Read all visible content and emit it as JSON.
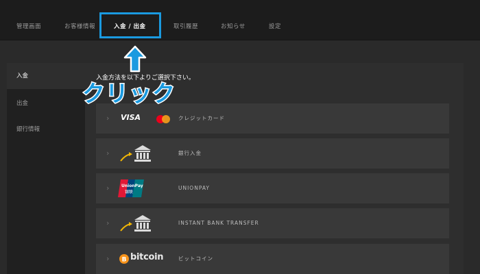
{
  "nav": {
    "tabs": [
      {
        "label": "管理画面"
      },
      {
        "label": "お客様情報"
      },
      {
        "label": "入金 / 出金"
      },
      {
        "label": "取引履歴"
      },
      {
        "label": "お知らせ"
      },
      {
        "label": "設定"
      }
    ],
    "active_tab": "入金 / 出金"
  },
  "annotation": {
    "callout_text": "クリック",
    "highlight_color": "#1a9ae0"
  },
  "sidebar": {
    "items": [
      {
        "label": "入金"
      },
      {
        "label": "出金"
      },
      {
        "label": "銀行情報"
      }
    ],
    "active_item": "入金"
  },
  "main": {
    "instruction": "入金方法を以下よりご選択下さい。",
    "methods": [
      {
        "logo": "visa-mastercard-logo",
        "logo_text": "VISA",
        "label": "クレジットカード"
      },
      {
        "logo": "bank-icon",
        "label": "銀行入金"
      },
      {
        "logo": "unionpay-logo",
        "label": "UNIONPAY"
      },
      {
        "logo": "bank-icon",
        "label": "INSTANT BANK TRANSFER"
      },
      {
        "logo": "bitcoin-logo",
        "logo_text": "bitcoin",
        "label": "ビットコイン"
      }
    ]
  },
  "colors": {
    "page_bg": "#2a2a2a",
    "topbar_bg": "#1c1c1c",
    "row_bg": "#393939",
    "accent_blue": "#1a9ae0",
    "mastercard_red": "#eb001b",
    "mastercard_yellow": "#f79e1b"
  }
}
